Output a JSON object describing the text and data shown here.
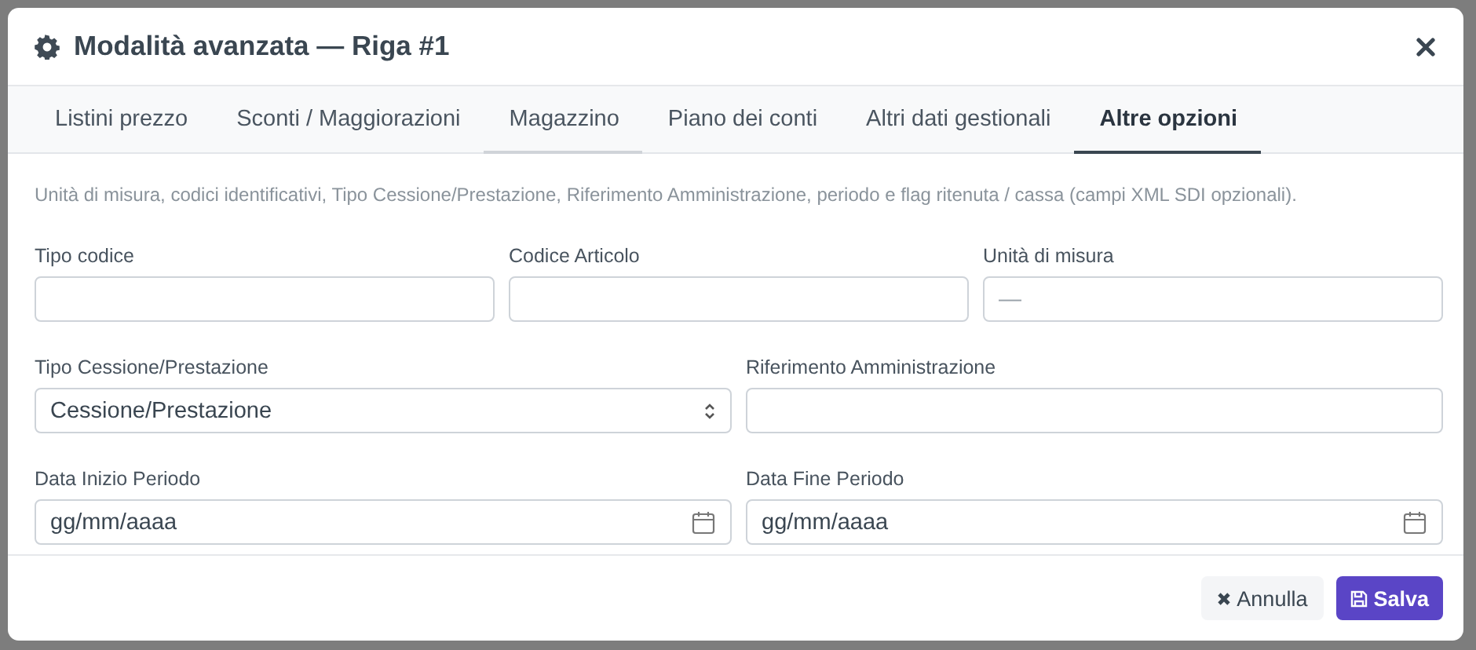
{
  "dialog": {
    "title": "Modalità avanzata — Riga #1"
  },
  "tabs": [
    {
      "label": "Listini prezzo",
      "selected": false,
      "hover": false
    },
    {
      "label": "Sconti / Maggiorazioni",
      "selected": false,
      "hover": false
    },
    {
      "label": "Magazzino",
      "selected": false,
      "hover": true
    },
    {
      "label": "Piano dei conti",
      "selected": false,
      "hover": false
    },
    {
      "label": "Altri dati gestionali",
      "selected": false,
      "hover": false
    },
    {
      "label": "Altre opzioni",
      "selected": true,
      "hover": false
    }
  ],
  "description": "Unità di misura, codici identificativi, Tipo Cessione/Prestazione, Riferimento Amministrazione, periodo e flag ritenuta / cassa (campi XML SDI opzionali).",
  "rows": [
    [
      {
        "kind": "text",
        "label": "Tipo codice"
      },
      {
        "kind": "text",
        "label": "Codice Articolo"
      },
      {
        "kind": "text",
        "label": "Unità di misura",
        "placeholder": "—"
      }
    ],
    [
      {
        "kind": "select",
        "label": "Tipo Cessione/Prestazione",
        "value": "Cessione/Prestazione"
      },
      {
        "kind": "text",
        "label": "Riferimento Amministrazione"
      }
    ],
    [
      {
        "kind": "date",
        "label": "Data Inizio Periodo",
        "value": "gg/mm/aaaa"
      },
      {
        "kind": "date",
        "label": "Data Fine Periodo",
        "value": "gg/mm/aaaa"
      }
    ]
  ],
  "buttons": [
    {
      "kind": "secondary",
      "label": "Annulla"
    },
    {
      "kind": "primary",
      "label": "Salva"
    }
  ]
}
